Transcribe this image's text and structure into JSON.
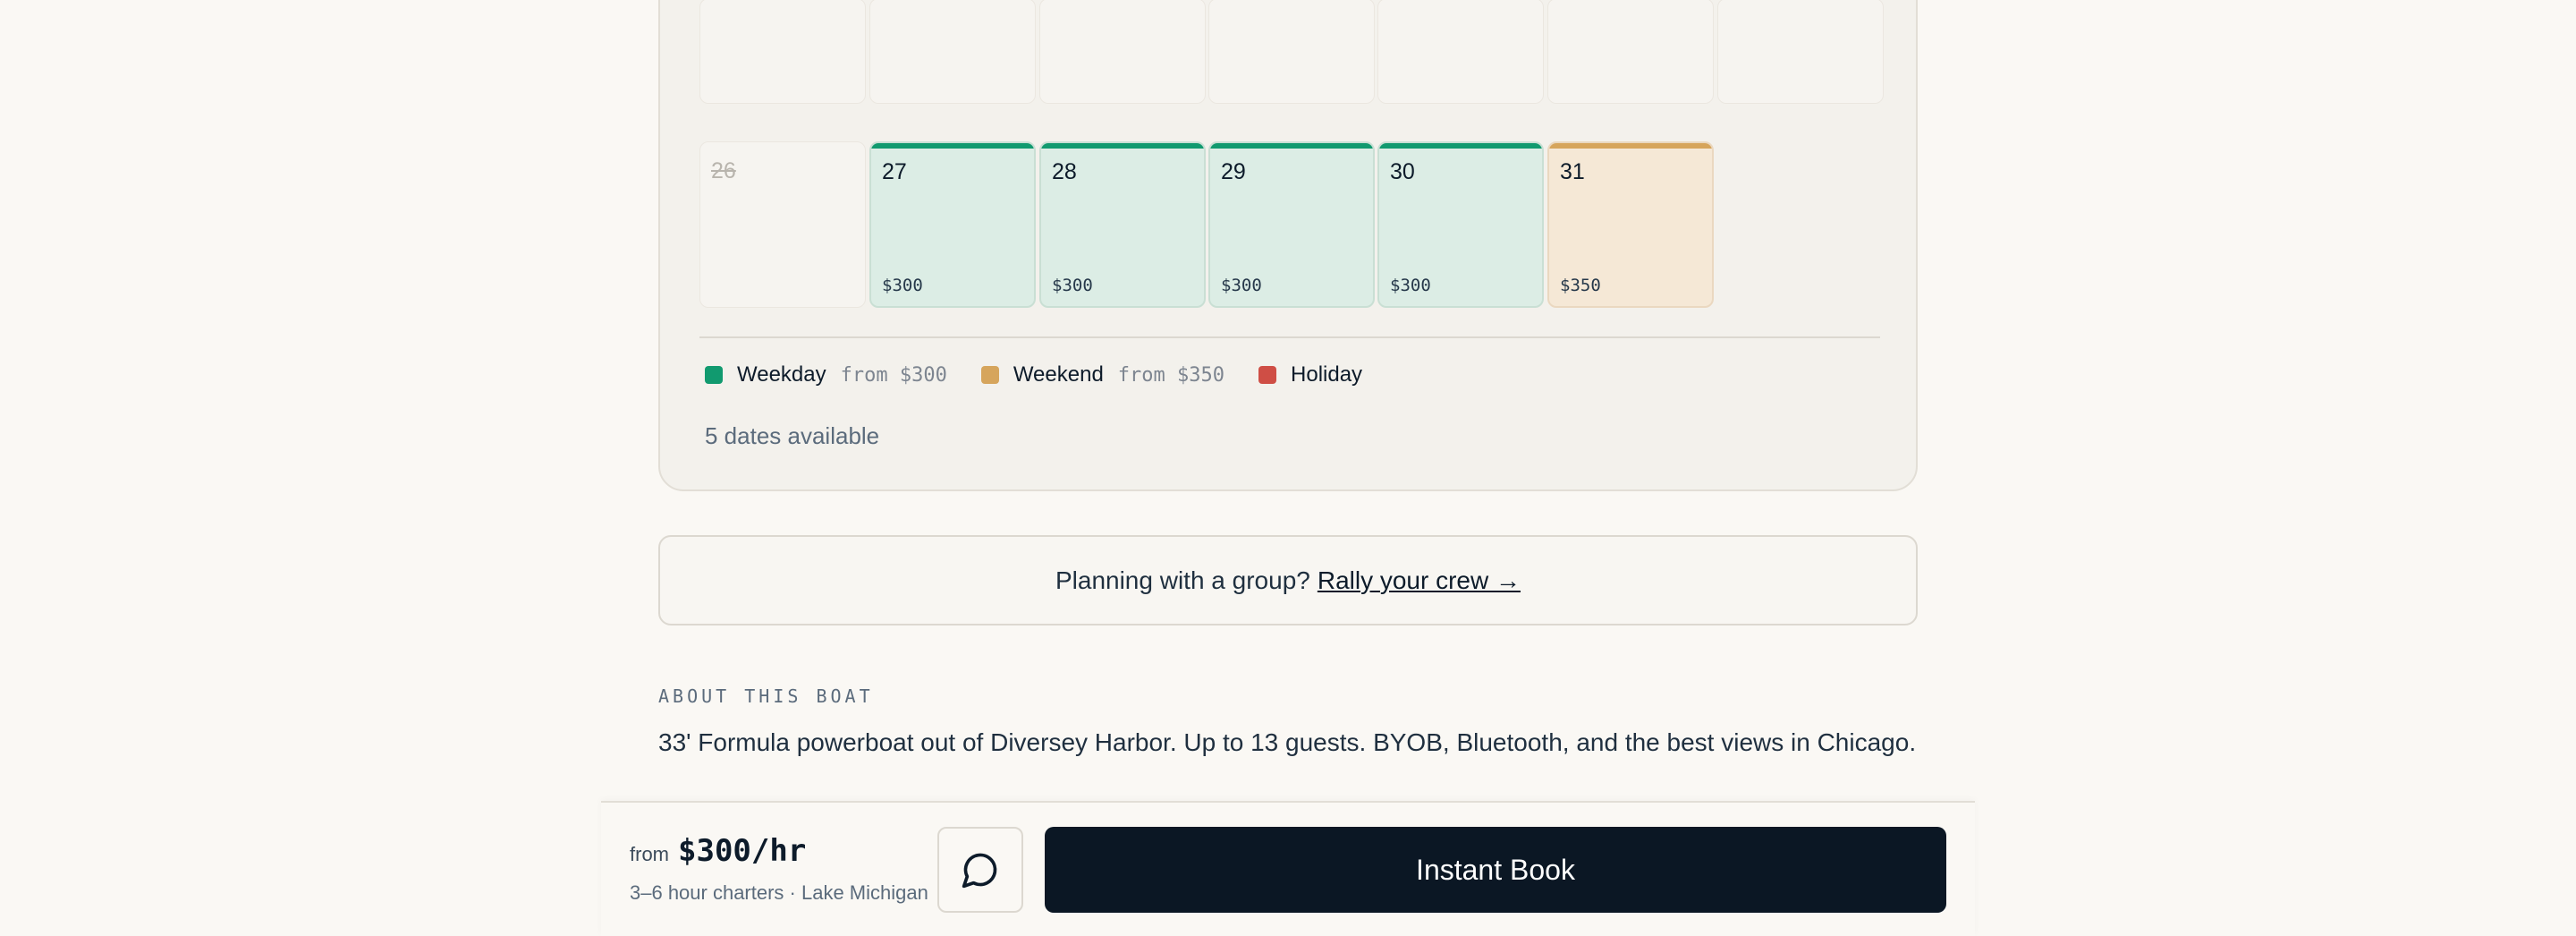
{
  "calendar": {
    "days": [
      {
        "day": "26",
        "state": "past",
        "price": ""
      },
      {
        "day": "27",
        "state": "weekday",
        "price": "$300"
      },
      {
        "day": "28",
        "state": "weekday",
        "price": "$300"
      },
      {
        "day": "29",
        "state": "weekday",
        "price": "$300"
      },
      {
        "day": "30",
        "state": "weekday",
        "price": "$300"
      },
      {
        "day": "31",
        "state": "weekend",
        "price": "$350"
      }
    ],
    "legend": [
      {
        "label": "Weekday",
        "from": "from $300",
        "color": "#119a6f"
      },
      {
        "label": "Weekend",
        "from": "from $350",
        "color": "#d6a55c"
      },
      {
        "label": "Holiday",
        "from": "",
        "color": "#cf4e45"
      }
    ],
    "available_text": "5 dates available"
  },
  "group": {
    "prompt": "Planning with a group?",
    "link": "Rally your crew →"
  },
  "about": {
    "heading": "ABOUT THIS BOAT",
    "text": "33' Formula powerboat out of Diversey Harbor. Up to 13 guests. BYOB, Bluetooth, and the best views in Chicago."
  },
  "footer": {
    "from_label": "from",
    "price": "$300/hr",
    "subtext": "3–6 hour charters · Lake Michigan",
    "message_icon": "chat-bubble-icon",
    "book_label": "Instant Book"
  }
}
